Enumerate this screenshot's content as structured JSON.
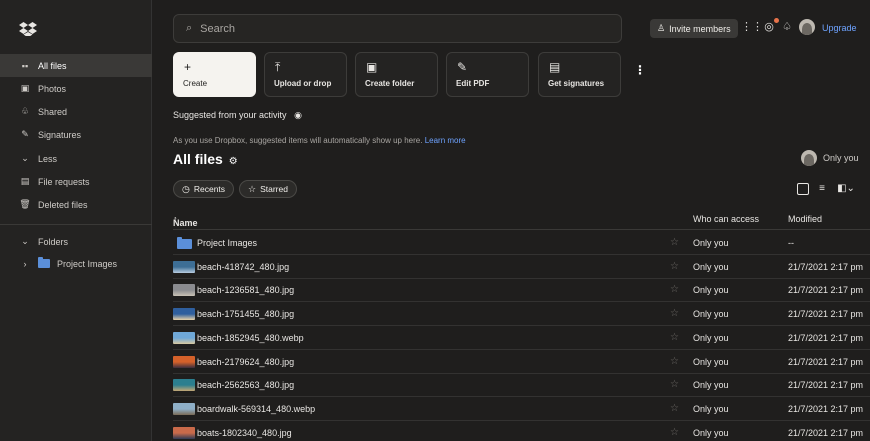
{
  "sidebar": {
    "items": [
      {
        "label": "All files",
        "icon": "all-files-icon",
        "glyph": "▪▪"
      },
      {
        "label": "Photos",
        "icon": "photos-icon",
        "glyph": "▣"
      },
      {
        "label": "Shared",
        "icon": "shared-icon",
        "glyph": "♧"
      },
      {
        "label": "Signatures",
        "icon": "signatures-icon",
        "glyph": "✎"
      },
      {
        "label": "Less",
        "icon": "chevron-down-icon",
        "glyph": "⌄"
      },
      {
        "label": "File requests",
        "icon": "file-requests-icon",
        "glyph": "▤"
      },
      {
        "label": "Deleted files",
        "icon": "trash-icon",
        "glyph": "🗑"
      }
    ],
    "folders_label": "Folders",
    "folder_item": "Project Images"
  },
  "header": {
    "search_placeholder": "Search",
    "invite_label": "Invite members",
    "upgrade_label": "Upgrade"
  },
  "actions": [
    {
      "label": "Create",
      "glyph": "+"
    },
    {
      "label": "Upload or drop",
      "glyph": "⤒"
    },
    {
      "label": "Create folder",
      "glyph": "▣"
    },
    {
      "label": "Edit PDF",
      "glyph": "✎"
    },
    {
      "label": "Get signatures",
      "glyph": "▤"
    }
  ],
  "suggested": {
    "title": "Suggested from your activity",
    "description": "As you use Dropbox, suggested items will automatically show up here.",
    "learn_more": "Learn more"
  },
  "page": {
    "title": "All files",
    "owner_label": "Only you"
  },
  "filters": {
    "recents": "Recents",
    "starred": "Starred"
  },
  "table": {
    "col_name": "Name",
    "col_access": "Who can access",
    "col_modified": "Modified",
    "rows": [
      {
        "name": "Project Images",
        "type": "folder",
        "access": "Only you",
        "modified": "--",
        "colors": [
          "#5b8fd9",
          "#5b8fd9"
        ]
      },
      {
        "name": "beach-418742_480.jpg",
        "type": "image",
        "access": "Only you",
        "modified": "21/7/2021 2:17 pm",
        "colors": [
          "#3d6e95",
          "#b9cde0"
        ]
      },
      {
        "name": "beach-1236581_480.jpg",
        "type": "image",
        "access": "Only you",
        "modified": "21/7/2021 2:17 pm",
        "colors": [
          "#8a8b8f",
          "#c9c2b5"
        ]
      },
      {
        "name": "beach-1751455_480.jpg",
        "type": "image",
        "access": "Only you",
        "modified": "21/7/2021 2:17 pm",
        "colors": [
          "#2f5f9e",
          "#e8d2a8"
        ]
      },
      {
        "name": "beach-1852945_480.webp",
        "type": "image",
        "access": "Only you",
        "modified": "21/7/2021 2:17 pm",
        "colors": [
          "#6fa8d8",
          "#d9c8a0"
        ]
      },
      {
        "name": "beach-2179624_480.jpg",
        "type": "image",
        "access": "Only you",
        "modified": "21/7/2021 2:17 pm",
        "colors": [
          "#d4612a",
          "#3a2e3e"
        ]
      },
      {
        "name": "beach-2562563_480.jpg",
        "type": "image",
        "access": "Only you",
        "modified": "21/7/2021 2:17 pm",
        "colors": [
          "#2b7f8f",
          "#c4a875"
        ]
      },
      {
        "name": "boardwalk-569314_480.webp",
        "type": "image",
        "access": "Only you",
        "modified": "21/7/2021 2:17 pm",
        "colors": [
          "#8fb0c8",
          "#7a6a55"
        ]
      },
      {
        "name": "boats-1802340_480.jpg",
        "type": "image",
        "access": "Only you",
        "modified": "21/7/2021 2:17 pm",
        "colors": [
          "#c96a4a",
          "#2e3a55"
        ]
      }
    ]
  }
}
